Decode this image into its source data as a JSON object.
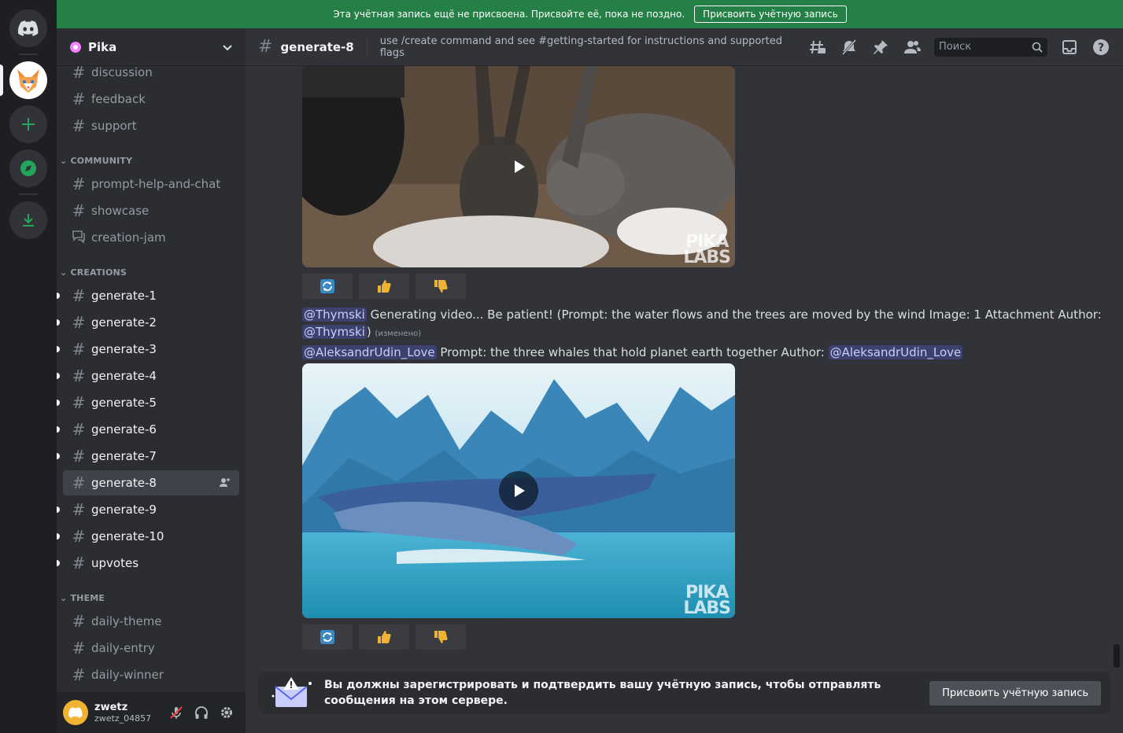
{
  "banner": {
    "text": "Эта учётная запись ещё не присвоена. Присвойте её, пока не поздно.",
    "button": "Присвоить учётную запись"
  },
  "server": {
    "name": "Pika"
  },
  "channels": [
    {
      "label": "discussion",
      "icon": "hash-icon"
    },
    {
      "label": "feedback",
      "icon": "hash-icon"
    },
    {
      "label": "support",
      "icon": "hash-icon"
    },
    {
      "label": "prompt-help-and-chat",
      "icon": "hash-icon"
    },
    {
      "label": "showcase",
      "icon": "hash-icon"
    },
    {
      "label": "creation-jam",
      "icon": "forum-icon"
    },
    {
      "label": "generate-1",
      "icon": "threads-hash-icon"
    },
    {
      "label": "generate-2",
      "icon": "threads-hash-icon"
    },
    {
      "label": "generate-3",
      "icon": "threads-hash-icon"
    },
    {
      "label": "generate-4",
      "icon": "threads-hash-icon"
    },
    {
      "label": "generate-5",
      "icon": "threads-hash-icon"
    },
    {
      "label": "generate-6",
      "icon": "threads-hash-icon"
    },
    {
      "label": "generate-7",
      "icon": "threads-hash-icon"
    },
    {
      "label": "generate-8",
      "icon": "threads-hash-icon"
    },
    {
      "label": "generate-9",
      "icon": "threads-hash-icon"
    },
    {
      "label": "generate-10",
      "icon": "threads-hash-icon"
    },
    {
      "label": "upvotes",
      "icon": "hash-icon"
    },
    {
      "label": "daily-theme",
      "icon": "hash-icon"
    },
    {
      "label": "daily-entry",
      "icon": "hash-icon"
    },
    {
      "label": "daily-winner",
      "icon": "hash-icon"
    }
  ],
  "categories": {
    "community": "COMMUNITY",
    "creations": "CREATIONS",
    "theme": "THEME"
  },
  "user": {
    "name": "zwetz",
    "tag": "zwetz_04857"
  },
  "header": {
    "channel": "generate-8",
    "topic": "use /create command and see #getting-started for instructions and supported flags",
    "search_placeholder": "Поиск"
  },
  "messages": {
    "m1_mention": "@Thymski",
    "m1_text": "Generating video... Be patient! (Prompt: the water flows and the trees are moved by the wind  Image: 1 Attachment  Author:",
    "m1_mention2": "@Thymski",
    "m1_close": ")",
    "m1_edited": "(изменено)",
    "m2_mention": "@AleksandrUdin_Love",
    "m2_text": "Prompt: the three whales that hold planet earth together  Author:",
    "m2_mention2": "@AleksandrUdin_Love"
  },
  "watermark": {
    "line1": "PIKA",
    "line2": "LABS"
  },
  "register": {
    "text": "Вы должны зарегистрировать и подтвердить вашу учётную запись, чтобы отправлять сообщения на этом сервере.",
    "button": "Присвоить учётную запись"
  },
  "colors": {
    "banner": "#248046",
    "mention": "#3c4270",
    "brand": "#5865f2"
  }
}
